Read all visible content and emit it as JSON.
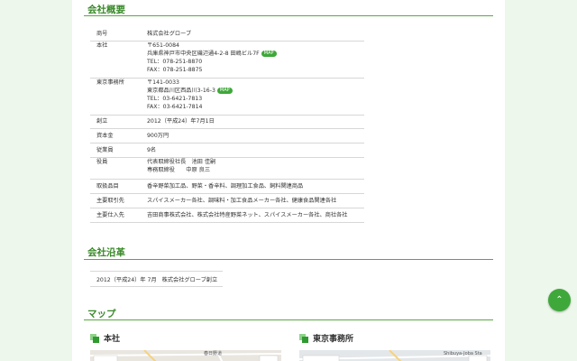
{
  "sections": {
    "overview": "会社概要",
    "history": "会社沿革",
    "map": "マップ"
  },
  "company": {
    "name_label": "商号",
    "name": "株式会社グローブ",
    "hq_label": "本社",
    "hq_lines": [
      "〒651-0084",
      "兵庫県神戸市中央区磯辺通4-2-8 田嶋ビル7F",
      "TEL：078-251-8870",
      "FAX：078-251-8875"
    ],
    "tokyo_label": "東京事務所",
    "tokyo_lines": [
      "〒141-0033",
      "東京都品川区西品川3-16-3",
      "TEL：03-6421-7813",
      "FAX：03-6421-7814"
    ],
    "map_badge": "MAP",
    "founded_label": "創立",
    "founded": "2012（平成24）年7月1日",
    "capital_label": "資本金",
    "capital": "900万円",
    "employees_label": "従業員",
    "employees": "9名",
    "officers_label": "役員",
    "officers_lines": [
      "代表取締役社長　池田 佳嗣",
      "専務取締役　　中原 良三"
    ],
    "products_label": "取扱品目",
    "products": "香辛野菜加工品、野菜・香辛料、調理加工食品、飼料関連商品",
    "customers_label": "主要取引先",
    "customers": "スパイスメーカー各社、調味料・加工食品メーカー各社、健康食品関連各社",
    "suppliers_label": "主要仕入先",
    "suppliers": "吉田商事株式会社、株式会社特産野菜ネット、スパイスメーカー各社、商社各社"
  },
  "history": {
    "date": "2012（平成24）年 7月",
    "event": "株式会社グローブ創立"
  },
  "maps": {
    "hq_title": "本社",
    "tokyo_title": "東京事務所",
    "hq_map_label": "春日野道",
    "tokyo_map_label": "Shibuya-Joba Sta"
  },
  "colors": {
    "accent": "#3fa83a",
    "heading": "#3a8a2a",
    "background": "#edf7ec"
  },
  "icons": {
    "gotop": "chevron-up-icon",
    "subheading": "green-squares-icon"
  }
}
